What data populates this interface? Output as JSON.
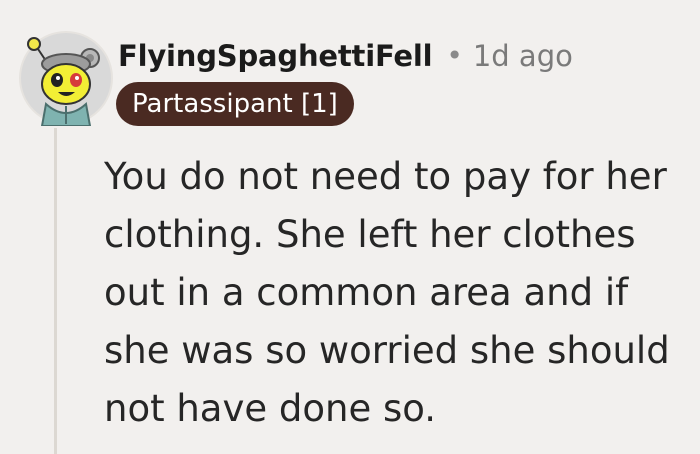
{
  "comment": {
    "author": "FlyingSpaghettiFell",
    "separator": "•",
    "time_ago": "1d ago",
    "flair": "Partassipant [1]",
    "body": "You do not need to pay for her clothing. She left her clothes out in a common area and if she was so worried she should not have done so."
  },
  "icons": {
    "avatar": "snoo-avatar"
  },
  "colors": {
    "background": "#f2f0ee",
    "flair_bg": "#4a2a22",
    "flair_text": "#ffffff",
    "username": "#1b1b1b",
    "meta": "#7a7a7a",
    "thread_line": "#dcd8d2"
  }
}
